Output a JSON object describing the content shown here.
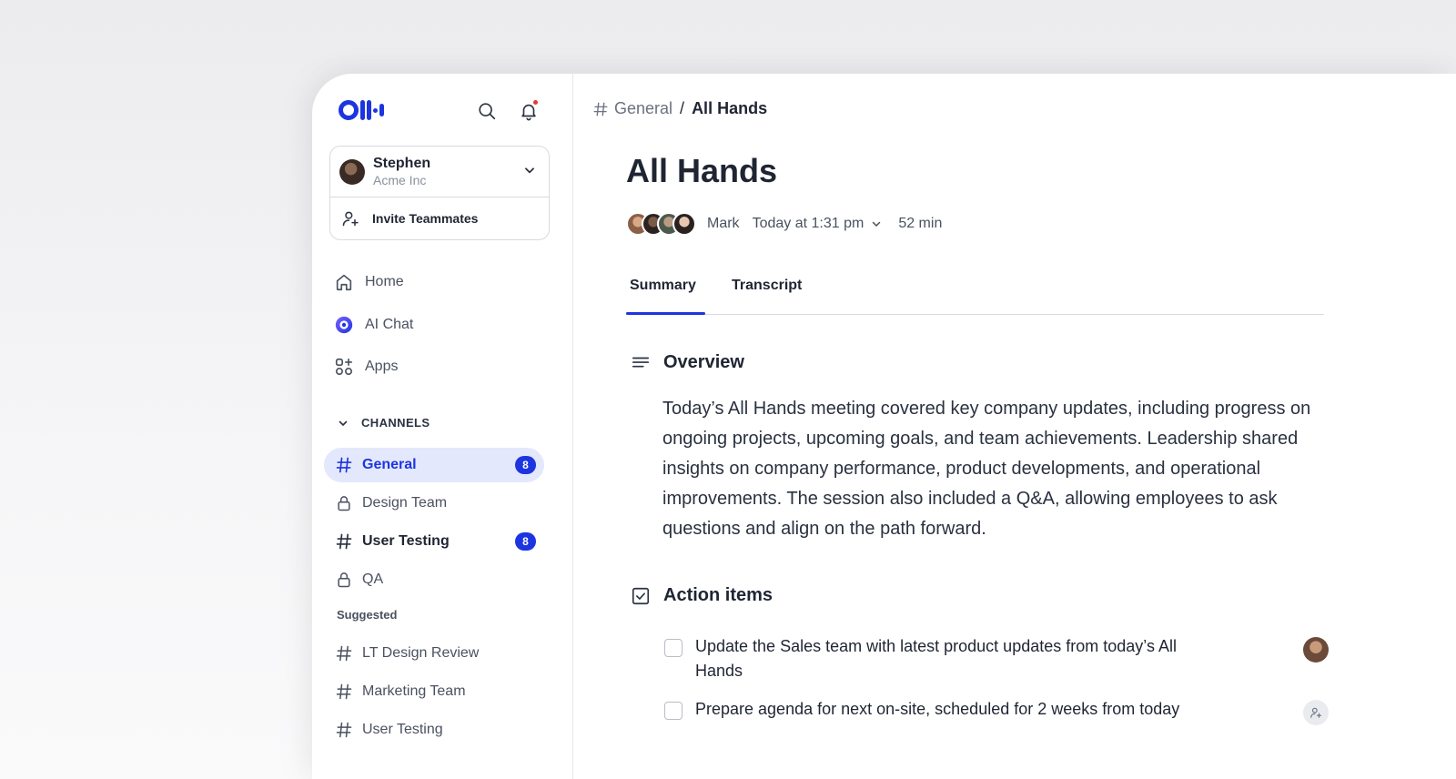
{
  "sidebar": {
    "user": {
      "name": "Stephen",
      "org": "Acme Inc"
    },
    "invite_label": "Invite Teammates",
    "nav": [
      {
        "label": "Home",
        "icon": "home-icon"
      },
      {
        "label": "AI Chat",
        "icon": "ai-chat-icon"
      },
      {
        "label": "Apps",
        "icon": "apps-icon"
      }
    ],
    "channels_header": "CHANNELS",
    "channels": [
      {
        "label": "General",
        "icon": "hash-icon",
        "badge": "8",
        "active": true
      },
      {
        "label": "Design Team",
        "icon": "lock-icon"
      },
      {
        "label": "User Testing",
        "icon": "hash-icon",
        "badge": "8"
      },
      {
        "label": "QA",
        "icon": "lock-icon"
      }
    ],
    "suggested_header": "Suggested",
    "suggested": [
      {
        "label": "LT Design Review",
        "icon": "hash-icon"
      },
      {
        "label": "Marketing Team",
        "icon": "hash-icon"
      },
      {
        "label": "User Testing",
        "icon": "hash-icon"
      }
    ]
  },
  "breadcrumb": {
    "parent": "General",
    "separator": "/",
    "current": "All Hands"
  },
  "meeting": {
    "title": "All Hands",
    "owner": "Mark",
    "date": "Today at 1:31 pm",
    "duration": "52 min"
  },
  "tabs": [
    {
      "label": "Summary",
      "active": true
    },
    {
      "label": "Transcript"
    }
  ],
  "overview": {
    "title": "Overview",
    "text": "Today’s All Hands meeting covered key company updates, including progress on ongoing projects, upcoming goals, and team achievements. Leadership shared insights on company performance, product developments, and operational improvements. The session also included a Q&A, allowing employees to ask questions and align on the path forward."
  },
  "action_items": {
    "title": "Action items",
    "items": [
      {
        "text": "Update the Sales team with latest product updates from today’s All Hands",
        "checked": false
      },
      {
        "text": "Prepare agenda for next on-site, scheduled for 2 weeks from today",
        "checked": false
      }
    ]
  },
  "colors": {
    "accent": "#1d35e0",
    "active_bg": "#e4e8fd",
    "notification": "#e53935"
  }
}
